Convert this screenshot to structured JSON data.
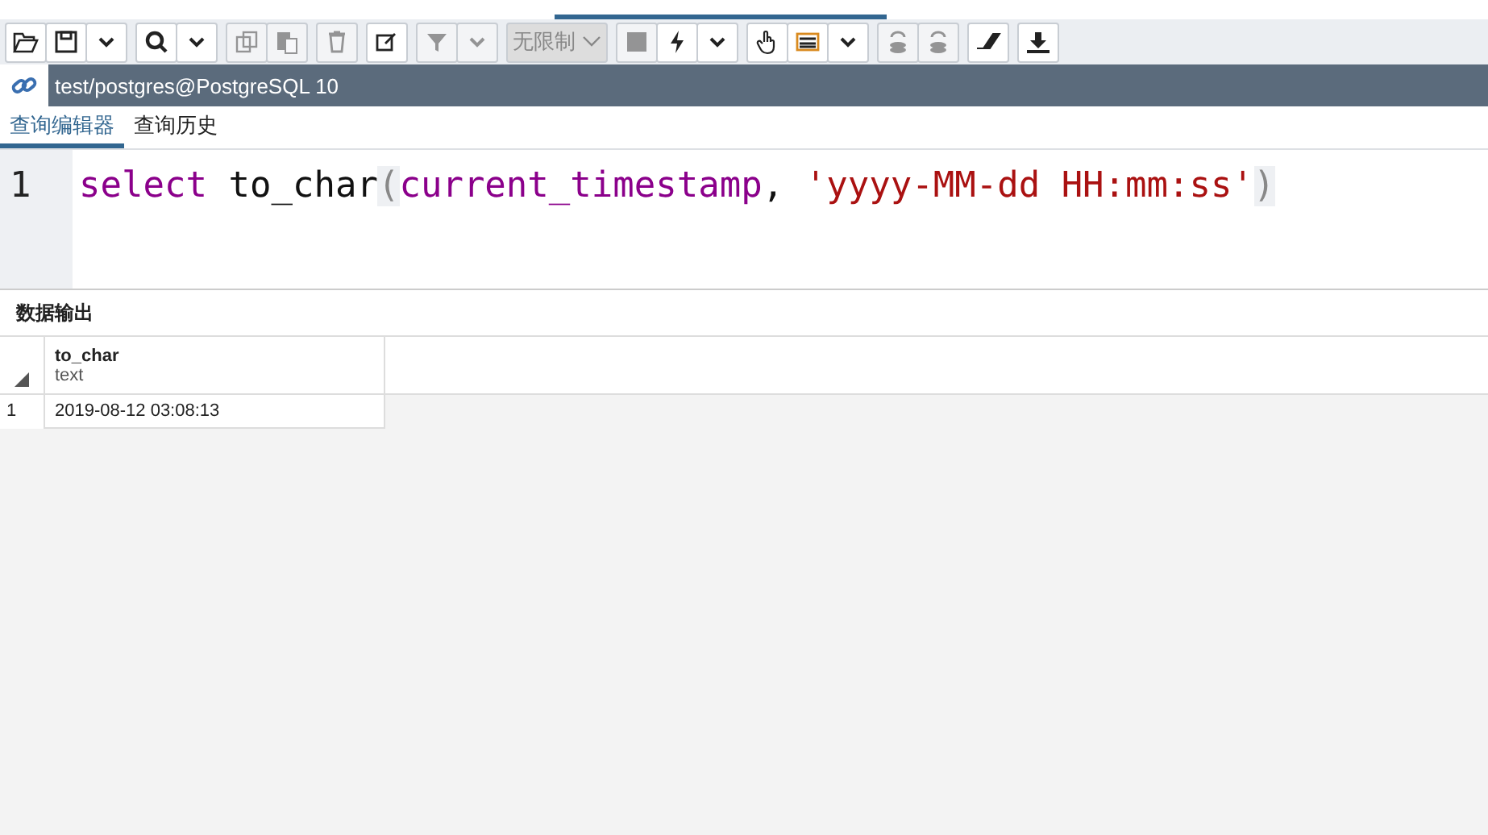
{
  "toolbar": {
    "groups": [
      {
        "items": [
          {
            "kind": "open",
            "disabled": false
          },
          {
            "kind": "save",
            "disabled": false
          },
          {
            "kind": "caret",
            "disabled": false
          }
        ]
      },
      {
        "items": [
          {
            "kind": "search",
            "disabled": false
          },
          {
            "kind": "caret",
            "disabled": false
          }
        ]
      },
      {
        "items": [
          {
            "kind": "copy",
            "disabled": true
          },
          {
            "kind": "paste",
            "disabled": true
          }
        ]
      },
      {
        "items": [
          {
            "kind": "delete",
            "disabled": true
          }
        ]
      },
      {
        "items": [
          {
            "kind": "edit",
            "disabled": false
          }
        ]
      },
      {
        "items": [
          {
            "kind": "filter",
            "disabled": true
          },
          {
            "kind": "caret",
            "disabled": true
          }
        ]
      },
      {
        "items": [
          {
            "kind": "limit",
            "disabled": true,
            "label": "无限制"
          }
        ]
      },
      {
        "items": [
          {
            "kind": "stop",
            "disabled": true
          },
          {
            "kind": "bolt",
            "disabled": false
          },
          {
            "kind": "caret",
            "disabled": false
          }
        ]
      },
      {
        "items": [
          {
            "kind": "hand",
            "disabled": false
          },
          {
            "kind": "grid",
            "disabled": false
          },
          {
            "kind": "caret",
            "disabled": false
          }
        ]
      },
      {
        "items": [
          {
            "kind": "commit",
            "disabled": true
          },
          {
            "kind": "rollback",
            "disabled": true
          }
        ]
      },
      {
        "items": [
          {
            "kind": "eraser",
            "disabled": false
          }
        ]
      },
      {
        "items": [
          {
            "kind": "download",
            "disabled": false
          }
        ]
      }
    ]
  },
  "connection": {
    "title": "test/postgres@PostgreSQL 10"
  },
  "editor_tabs": [
    {
      "label": "查询编辑器",
      "selected": true
    },
    {
      "label": "查询历史",
      "selected": false
    }
  ],
  "editor": {
    "lines": [
      {
        "number": "1",
        "tokens": [
          {
            "kind": "keyword",
            "text": "select"
          },
          {
            "kind": "plain",
            "text": " to_char"
          },
          {
            "kind": "paren",
            "text": "("
          },
          {
            "kind": "keyword",
            "text": "current_timestamp"
          },
          {
            "kind": "plain",
            "text": ", "
          },
          {
            "kind": "string",
            "text": "'yyyy-MM-dd HH:mm:ss'"
          },
          {
            "kind": "paren",
            "text": ")"
          }
        ]
      }
    ]
  },
  "output": {
    "title": "数据输出",
    "columns": [
      {
        "name": "to_char",
        "type": "text"
      }
    ],
    "rows": [
      {
        "number": "1",
        "cells": [
          "2019-08-12 03:08:13"
        ]
      }
    ]
  }
}
